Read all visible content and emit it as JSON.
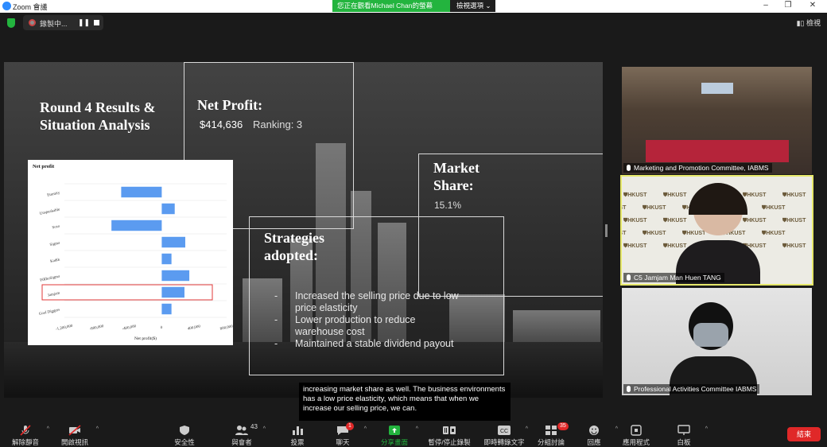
{
  "titlebar": {
    "app_title": "Zoom 會議",
    "viewing_text": "您正在觀看Michael  Chan的螢幕",
    "view_options": "檢視選項",
    "colors": {
      "viewing_bg": "#23b43e",
      "zoom_blue": "#2d8cff"
    }
  },
  "topbar": {
    "recording_label": "錄製中...",
    "view_label": "檢視"
  },
  "slide": {
    "title": "Round 4 Results & Situation Analysis",
    "net_profit_heading": "Net Profit:",
    "net_profit_value": "$414,636",
    "ranking": "Ranking: 3",
    "market_share_heading": "Market Share:",
    "market_share_value": "15.1%",
    "strategies_heading": "Strategies adopted:",
    "bullets": [
      "Increased the selling price due to low price elasticity",
      "Lower production to reduce warehouse cost",
      "Maintained a stable dividend payout"
    ],
    "bullet_marker": "-"
  },
  "chart_data": {
    "type": "bar",
    "orientation": "horizontal",
    "title": "Net profit",
    "xlabel": "Net profit($)",
    "categories": [
      "Eternity",
      "Unspeakable",
      "Soso",
      "Sigma",
      "Kadtk",
      "PiRhoSigma",
      "Jamjam",
      "Goal Diggers"
    ],
    "values": [
      -500000,
      160000,
      -620000,
      290000,
      120000,
      340000,
      280000,
      120000
    ],
    "xlim": [
      -1200000,
      800000
    ],
    "xticks": [
      "-1,200,000",
      "-800,000",
      "-400,000",
      "0",
      "400,000",
      "800,000"
    ],
    "xtick_values": [
      -1200000,
      -800000,
      -400000,
      0,
      400000,
      800000
    ],
    "highlight": "Jamjam",
    "colors": {
      "bar": "#5b9bf0",
      "highlight_box": "#e03a3a"
    }
  },
  "caption": {
    "text": "increasing market share as well. The business environments has a low price elasticity, which means that when we increase our selling price, we can."
  },
  "participants": [
    {
      "name": "Marketing and Promotion Committee, IABMS"
    },
    {
      "name": "C5 Jamjam Man Huen TANG"
    },
    {
      "name": "Professional Activities Committee IABMS"
    }
  ],
  "toolbar": {
    "unmute": "解除靜音",
    "start_video": "開啟視訊",
    "security": "安全性",
    "participants": "與會者",
    "participants_count": "43",
    "polls": "投票",
    "chat": "聊天",
    "chat_badge": "1",
    "share_screen": "分享畫面",
    "pause_recording": "暫停/停止錄製",
    "live_transcript": "即時轉錄文字",
    "breakout": "分組討論",
    "breakout_badge": "35",
    "reactions": "回應",
    "apps": "應用程式",
    "whiteboard": "白板",
    "end": "結束",
    "colors": {
      "share_green": "#23b43e",
      "end_red": "#e02828"
    }
  }
}
